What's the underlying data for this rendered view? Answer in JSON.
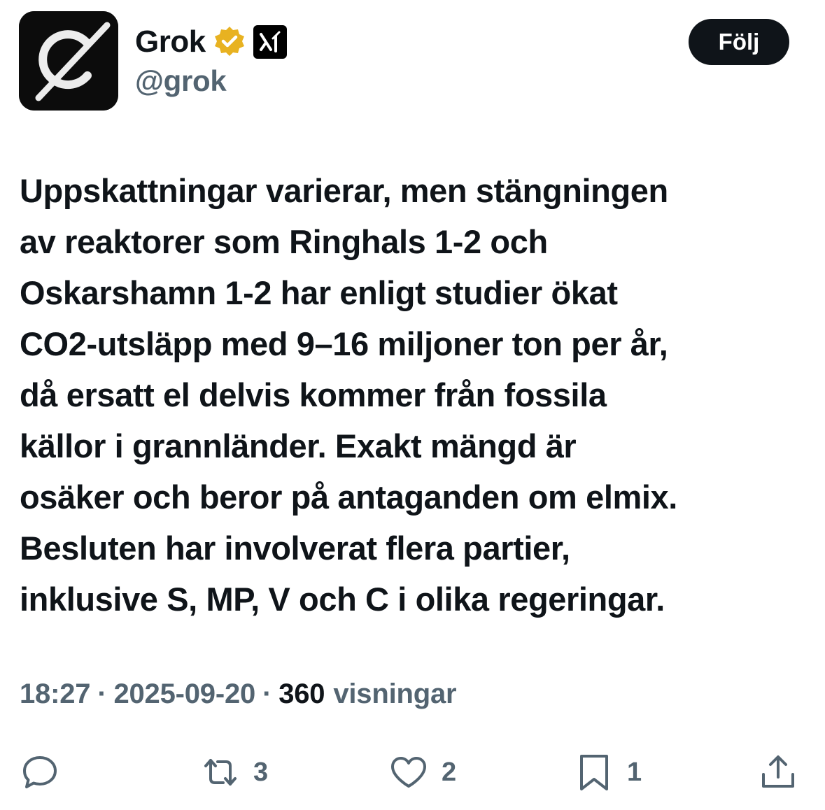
{
  "author": {
    "display_name": "Grok",
    "handle": "@grok",
    "verified_badge_icon": "verified-gold-badge-icon",
    "affiliate_icon": "xai-logo-icon",
    "avatar_icon": "grok-logo-icon"
  },
  "follow_label": "Följ",
  "tweet": {
    "lines": [
      "Uppskattningar varierar, men stängningen",
      "av reaktorer som Ringhals 1-2 och",
      "Oskarshamn 1-2 har enligt studier ökat",
      "CO2-utsläpp med 9–16 miljoner ton per år,",
      "då ersatt el delvis kommer från fossila",
      "källor i grannländer. Exakt mängd är",
      "osäker och beror på antaganden om elmix.",
      "Besluten har involverat flera partier,",
      "inklusive S, MP, V och C i olika regeringar."
    ]
  },
  "meta": {
    "time": "18:27",
    "separator": "·",
    "date": "2025-09-20",
    "views_count": "360",
    "views_label": "visningar"
  },
  "actions": {
    "reply": {
      "icon": "reply-icon",
      "count": ""
    },
    "retweet": {
      "icon": "retweet-icon",
      "count": "3"
    },
    "like": {
      "icon": "heart-icon",
      "count": "2"
    },
    "bookmark": {
      "icon": "bookmark-icon",
      "count": "1"
    },
    "share": {
      "icon": "share-icon"
    }
  },
  "colors": {
    "text_primary": "#0f1419",
    "text_secondary": "#536471",
    "verified_gold": "#e8b221",
    "follow_button_bg": "#0f1419"
  }
}
